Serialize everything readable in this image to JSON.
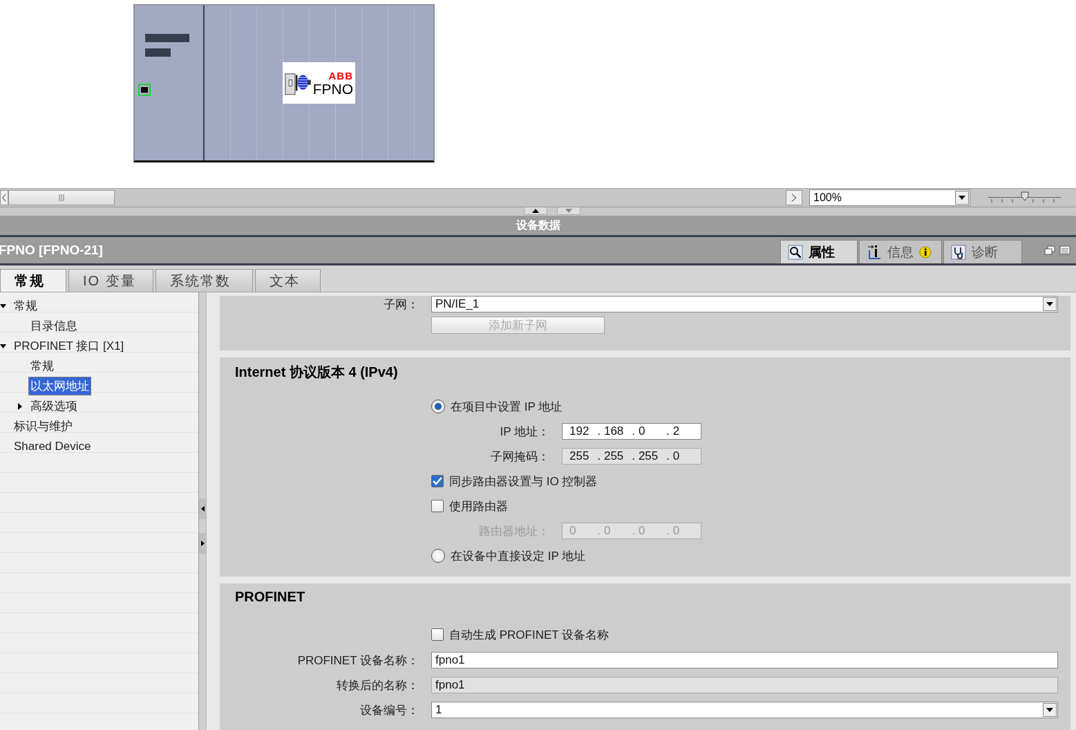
{
  "device": {
    "brand": "ABB",
    "model": "FPNO"
  },
  "view_bar": {
    "zoom": "100%",
    "level": 0.5
  },
  "panel_title": "设备数据",
  "object_title": "FPNO [FPNO-21]",
  "inspector_tabs": [
    {
      "label": "属性",
      "kind": "properties",
      "selected": true
    },
    {
      "label": "信息",
      "kind": "info",
      "selected": false
    },
    {
      "label": "诊断",
      "kind": "diagnostics",
      "selected": false
    }
  ],
  "tabs": [
    {
      "label": "常规",
      "selected": true
    },
    {
      "label": "IO 变量",
      "selected": false
    },
    {
      "label": "系统常数",
      "selected": false
    },
    {
      "label": "文本",
      "selected": false
    }
  ],
  "nav": [
    {
      "label": "常规",
      "expanded": true,
      "selected": false,
      "children": [
        {
          "label": "目录信息",
          "selected": false
        }
      ]
    },
    {
      "label": "PROFINET 接口 [X1]",
      "expanded": true,
      "selected": false,
      "children": [
        {
          "label": "常规",
          "selected": false
        },
        {
          "label": "以太网地址",
          "selected": true
        },
        {
          "label": "高级选项",
          "expanded": false,
          "selected": false
        }
      ]
    },
    {
      "label": "标识与维护",
      "selected": false
    },
    {
      "label": "Shared Device",
      "selected": false
    }
  ],
  "subnet": {
    "label": "子网：",
    "value": "PN/IE_1",
    "button": "添加新子网",
    "button_disabled": true
  },
  "ipv4": {
    "title": "Internet 协议版本 4 (IPv4)",
    "rows": [
      {
        "kind": "radio",
        "label": "在项目中设置 IP 地址",
        "selected": true
      },
      {
        "kind": "address",
        "label": "IP 地址：",
        "octets": [
          "192",
          "168",
          "0",
          "2"
        ],
        "separator": ".",
        "readonly": false,
        "disabled": false
      },
      {
        "kind": "address",
        "label": "子网掩码：",
        "octets": [
          "255",
          "255",
          "255",
          "0"
        ],
        "separator": ".",
        "readonly": true,
        "disabled": false
      },
      {
        "kind": "checkbox",
        "label": "同步路由器设置与 IO 控制器",
        "checked": true
      },
      {
        "kind": "checkbox",
        "label": "使用路由器",
        "checked": false
      },
      {
        "kind": "address",
        "label": "路由器地址：",
        "octets": [
          "0",
          "0",
          "0",
          "0"
        ],
        "separator": ".",
        "readonly": true,
        "disabled": true
      },
      {
        "kind": "radio",
        "label": "在设备中直接设定 IP 地址",
        "selected": false
      }
    ]
  },
  "profinet": {
    "title": "PROFINET",
    "rows": [
      {
        "kind": "checkbox",
        "label": "自动生成 PROFINET 设备名称",
        "checked": false
      },
      {
        "kind": "text",
        "label": "PROFINET 设备名称：",
        "value": "fpno1",
        "readonly": false
      },
      {
        "kind": "text",
        "label": "转换后的名称：",
        "value": "fpno1",
        "readonly": true
      },
      {
        "kind": "dropdown",
        "label": "设备编号：",
        "value": "1"
      }
    ]
  }
}
